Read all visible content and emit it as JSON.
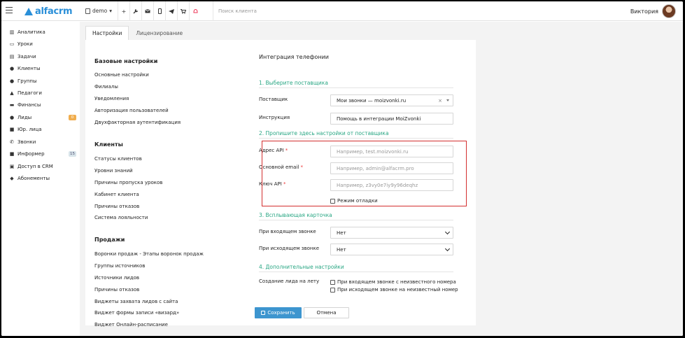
{
  "topbar": {
    "logo_text": "alfacrm",
    "branch": "demo",
    "icons": [
      "plus-icon",
      "wrench-icon",
      "mail-icon",
      "phone-icon",
      "telegram-icon",
      "cart-icon",
      "bell-icon"
    ],
    "search_placeholder": "Поиск клиента",
    "user_name": "Виктория"
  },
  "sidebar": {
    "items": [
      {
        "label": "Аналитика",
        "icon": "chart-icon"
      },
      {
        "label": "Уроки",
        "icon": "calendar-icon"
      },
      {
        "label": "Задачи",
        "icon": "tasks-icon"
      },
      {
        "label": "Клиенты",
        "icon": "user-icon"
      },
      {
        "label": "Группы",
        "icon": "users-icon"
      },
      {
        "label": "Педагоги",
        "icon": "graduation-cap-icon"
      },
      {
        "label": "Финансы",
        "icon": "money-icon"
      },
      {
        "label": "Лиды",
        "icon": "lead-icon",
        "badge": "0"
      },
      {
        "label": "Юр. лица",
        "icon": "briefcase-icon"
      },
      {
        "label": "Звонки",
        "icon": "phone-icon"
      },
      {
        "label": "Информер",
        "icon": "informer-icon",
        "badge": "15"
      },
      {
        "label": "Доступ в CRM",
        "icon": "lock-icon"
      },
      {
        "label": "Абонементы",
        "icon": "tag-icon"
      }
    ]
  },
  "tabs": [
    {
      "label": "Настройки",
      "active": true
    },
    {
      "label": "Лицензирование",
      "active": false
    }
  ],
  "left_menu": {
    "sections": [
      {
        "title": "Базовые настройки",
        "links": [
          "Основные настройки",
          "Филиалы",
          "Уведомления",
          "Авторизация пользователей",
          "Двухфакторная аутентификация"
        ]
      },
      {
        "title": "Клиенты",
        "links": [
          "Статусы клиентов",
          "Уровни знаний",
          "Причины пропуска уроков",
          "Кабинет клиента",
          "Причины отказов",
          "Система лояльности"
        ]
      },
      {
        "title": "Продажи",
        "links": [
          "Воронки продаж - Этапы воронок продаж",
          "Группы источников",
          "Источники лидов",
          "Причины отказов",
          "Виджеты захвата лидов с сайта",
          "Виджет формы записи «визард»",
          "Виджет Онлайн-расписание"
        ]
      }
    ]
  },
  "form": {
    "title": "Интеграция телефонии",
    "step1": "1. Выберите поставщика",
    "provider_label": "Поставщик",
    "provider_value": "Мои звонки — moizvonki.ru",
    "instruction_label": "Инструкция",
    "instruction_value": "Помощь в интеграции MoiZvonki",
    "step2": "2. Пропишите здесь настройки от поставщика",
    "api_address_label": "Адрес API",
    "api_address_placeholder": "Например, test.moizvonki.ru",
    "email_label": "Основной email",
    "email_placeholder": "Например, admin@alfacrm.pro",
    "api_key_label": "Ключ API",
    "api_key_placeholder": "Например, z3vy0e7iy9y96deqhz",
    "required_mark": "*",
    "debug_label": "Режим отладки",
    "step3": "3. Всплывающая карточка",
    "incoming_label": "При входящем звонке",
    "incoming_value": "Нет",
    "outgoing_label": "При исходящем звонке",
    "outgoing_value": "Нет",
    "step4": "4. Дополнительные настройки",
    "lead_label": "Создание лида на лету",
    "lead_opt1": "При входящем звонке с неизвестного номера",
    "lead_opt2": "При исходящем звонке на неизвестный номер",
    "save_label": "Сохранить",
    "cancel_label": "Отмена"
  },
  "colors": {
    "accent": "#3d95cf",
    "green_heading": "#2aa784",
    "highlight_border": "#d32f2f",
    "badge_orange": "#f0ad4e"
  }
}
